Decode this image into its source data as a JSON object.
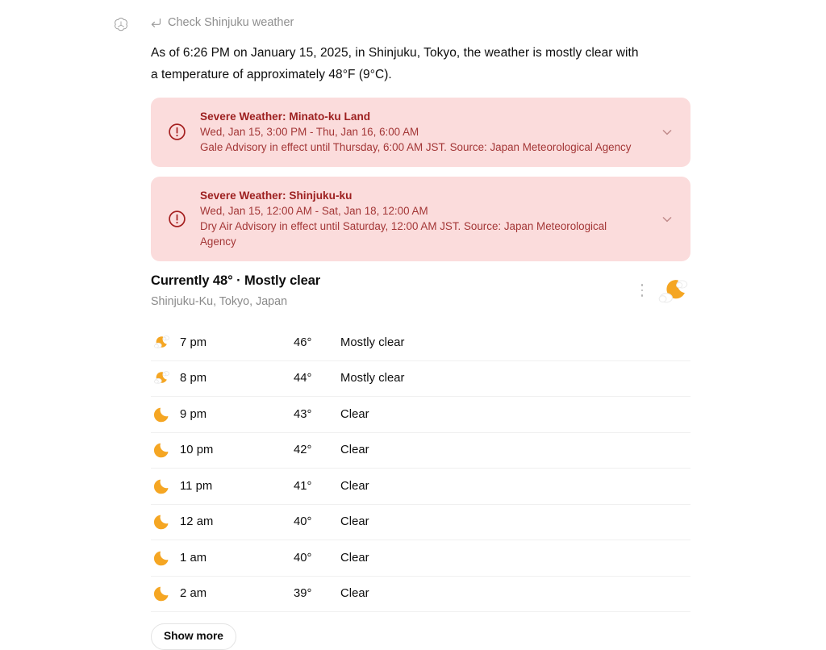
{
  "assistant": {
    "avatar_icon": "openai-logo-icon"
  },
  "tool_call": {
    "icon": "return-arrow-icon",
    "label": "Check Shinjuku weather"
  },
  "message": {
    "paragraph": "As of 6:26 PM on January 15, 2025, in Shinjuku, Tokyo, the weather is mostly clear with a temperature of approximately 48°F (9°C)."
  },
  "alerts": [
    {
      "icon": "alert-circle-icon",
      "title": "Severe Weather: Minato-ku Land",
      "time_range": "Wed, Jan 15, 3:00 PM - Thu, Jan 16, 6:00 AM",
      "description": "Gale Advisory in effect until Thursday, 6:00 AM JST. Source: Japan Meteorological Agency",
      "expand_icon": "chevron-down-icon"
    },
    {
      "icon": "alert-circle-icon",
      "title": "Severe Weather: Shinjuku-ku",
      "time_range": "Wed, Jan 15, 12:00 AM - Sat, Jan 18, 12:00 AM",
      "description": "Dry Air Advisory in effect until Saturday, 12:00 AM JST. Source: Japan Meteorological Agency",
      "expand_icon": "chevron-down-icon"
    }
  ],
  "weather": {
    "current_title": "Currently 48° · Mostly clear",
    "location": "Shinjuku-Ku, Tokyo, Japan",
    "current_icon": "moon-with-clouds-icon",
    "menu_icon": "kebab-menu-icon",
    "hours": [
      {
        "icon": "moon-with-cloud-icon",
        "time": "7 pm",
        "temp": "46°",
        "condition": "Mostly clear"
      },
      {
        "icon": "moon-with-cloud-icon",
        "time": "8 pm",
        "temp": "44°",
        "condition": "Mostly clear"
      },
      {
        "icon": "moon-icon",
        "time": "9 pm",
        "temp": "43°",
        "condition": "Clear"
      },
      {
        "icon": "moon-icon",
        "time": "10 pm",
        "temp": "42°",
        "condition": "Clear"
      },
      {
        "icon": "moon-icon",
        "time": "11 pm",
        "temp": "41°",
        "condition": "Clear"
      },
      {
        "icon": "moon-icon",
        "time": "12 am",
        "temp": "40°",
        "condition": "Clear"
      },
      {
        "icon": "moon-icon",
        "time": "1 am",
        "temp": "40°",
        "condition": "Clear"
      },
      {
        "icon": "moon-icon",
        "time": "2 am",
        "temp": "39°",
        "condition": "Clear"
      }
    ],
    "show_more_label": "Show more"
  },
  "colors": {
    "alert_bg": "#fbdcdc",
    "alert_title": "#9d2020",
    "alert_text": "#a33636",
    "moon": "#f5a623",
    "text": "#0d0d0d",
    "muted": "#8a8a8a"
  }
}
